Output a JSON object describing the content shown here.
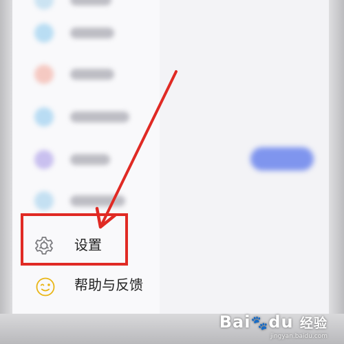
{
  "menu": {
    "blurred_items": [
      {
        "icon_color": "#b9ddf3",
        "label_width": 64
      },
      {
        "icon_color": "#f5c9c2",
        "label_width": 64
      },
      {
        "icon_color": "#b9dcf3",
        "label_width": 86
      },
      {
        "icon_color": "#c9c0ef",
        "label_width": 58
      },
      {
        "icon_color": "#c4e0f2",
        "label_width": 80
      }
    ],
    "settings": {
      "label": "设置",
      "icon": "gear-icon"
    },
    "help": {
      "label": "帮助与反馈",
      "icon": "smiley-face-icon"
    }
  },
  "annotation": {
    "color": "#e02a24"
  },
  "colors": {
    "accent_button": "#7f95ee",
    "help_icon": "#e9b514"
  },
  "watermark": {
    "logo_bai": "Bai",
    "logo_du": "du",
    "logo_jingyan": "经验",
    "url": "jingyan.baidu.com"
  }
}
